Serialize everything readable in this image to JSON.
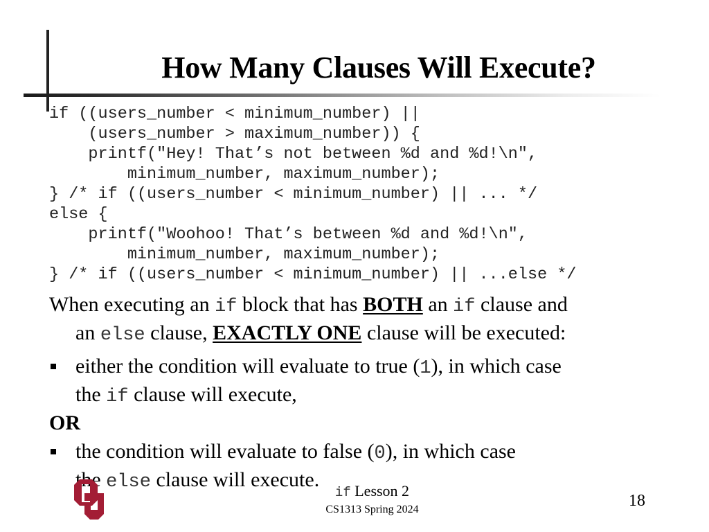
{
  "slide": {
    "title": "How Many Clauses Will Execute?",
    "code_lines": [
      "if ((users_number < minimum_number) ||",
      "    (users_number > maximum_number)) {",
      "    printf(\"Hey! That’s not between %d and %d!\\n\",",
      "        minimum_number, maximum_number);",
      "} /* if ((users_number < minimum_number) || ... */",
      "else {",
      "    printf(\"Woohoo! That’s between %d and %d!\\n\",",
      "        minimum_number, maximum_number);",
      "} /* if ((users_number < minimum_number) || ...else */"
    ],
    "intro": {
      "t1": "When executing an ",
      "code_if": "if",
      "t2": " block that has ",
      "both": "BOTH",
      "t3": " an ",
      "code_if2": "if",
      "t4": " clause and",
      "t5": "an ",
      "code_else": "else",
      "t6": " clause, ",
      "exactly_one": "EXACTLY ONE",
      "t7": " clause will be executed:"
    },
    "bullet1": {
      "t1": "either the condition will evaluate to true (",
      "code_true": "1",
      "t2": "), in which case",
      "t3": "the ",
      "code_if": "if",
      "t4": " clause will execute,"
    },
    "or_label": "OR",
    "bullet2": {
      "t1": "the condition will evaluate to false (",
      "code_false": "0",
      "t2": "), in which case",
      "t3": "the ",
      "code_else": "else",
      "t4": " clause will execute."
    }
  },
  "footer": {
    "lesson_code": "if",
    "lesson_text": " Lesson 2",
    "course": "CS1313 Spring 2024",
    "page_number": "18"
  },
  "logo": {
    "name": "ou-logo-icon",
    "text": "OU",
    "color": "#a31d35"
  }
}
